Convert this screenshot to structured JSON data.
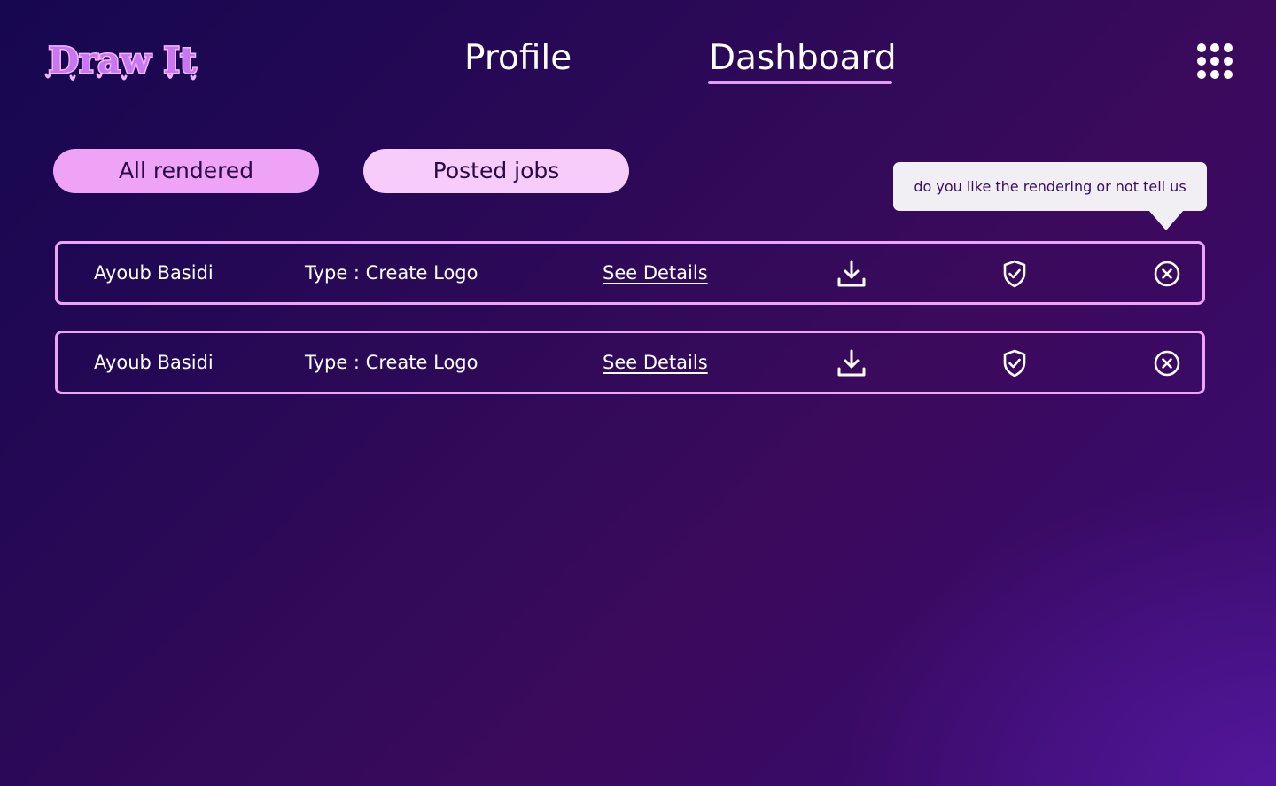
{
  "app": {
    "logo_text": "Draw It"
  },
  "nav": {
    "profile_label": "Profile",
    "dashboard_label": "Dashboard",
    "active": "Dashboard",
    "menu_icon": "grid-menu-icon"
  },
  "tabs": {
    "all_rendered_label": "All rendered",
    "posted_jobs_label": "Posted jobs"
  },
  "tooltip": {
    "text": "do you like the rendering or not tell us"
  },
  "jobs": [
    {
      "name": "Ayoub Basidi",
      "type": "Type : Create Logo",
      "details_link": "See Details",
      "actions": [
        "download-icon",
        "shield-check-icon",
        "close-circle-icon"
      ]
    },
    {
      "name": "Ayoub Basidi",
      "type": "Type : Create Logo",
      "details_link": "See Details",
      "actions": [
        "download-icon",
        "shield-check-icon",
        "close-circle-icon"
      ]
    }
  ],
  "colors": {
    "accent": "#eea3f7",
    "accent_light": "#f7ccfb",
    "tooltip_bg": "#f1eff3",
    "tooltip_text": "#3b0d61",
    "background_start": "#160750",
    "background_end": "#3d0d72"
  }
}
